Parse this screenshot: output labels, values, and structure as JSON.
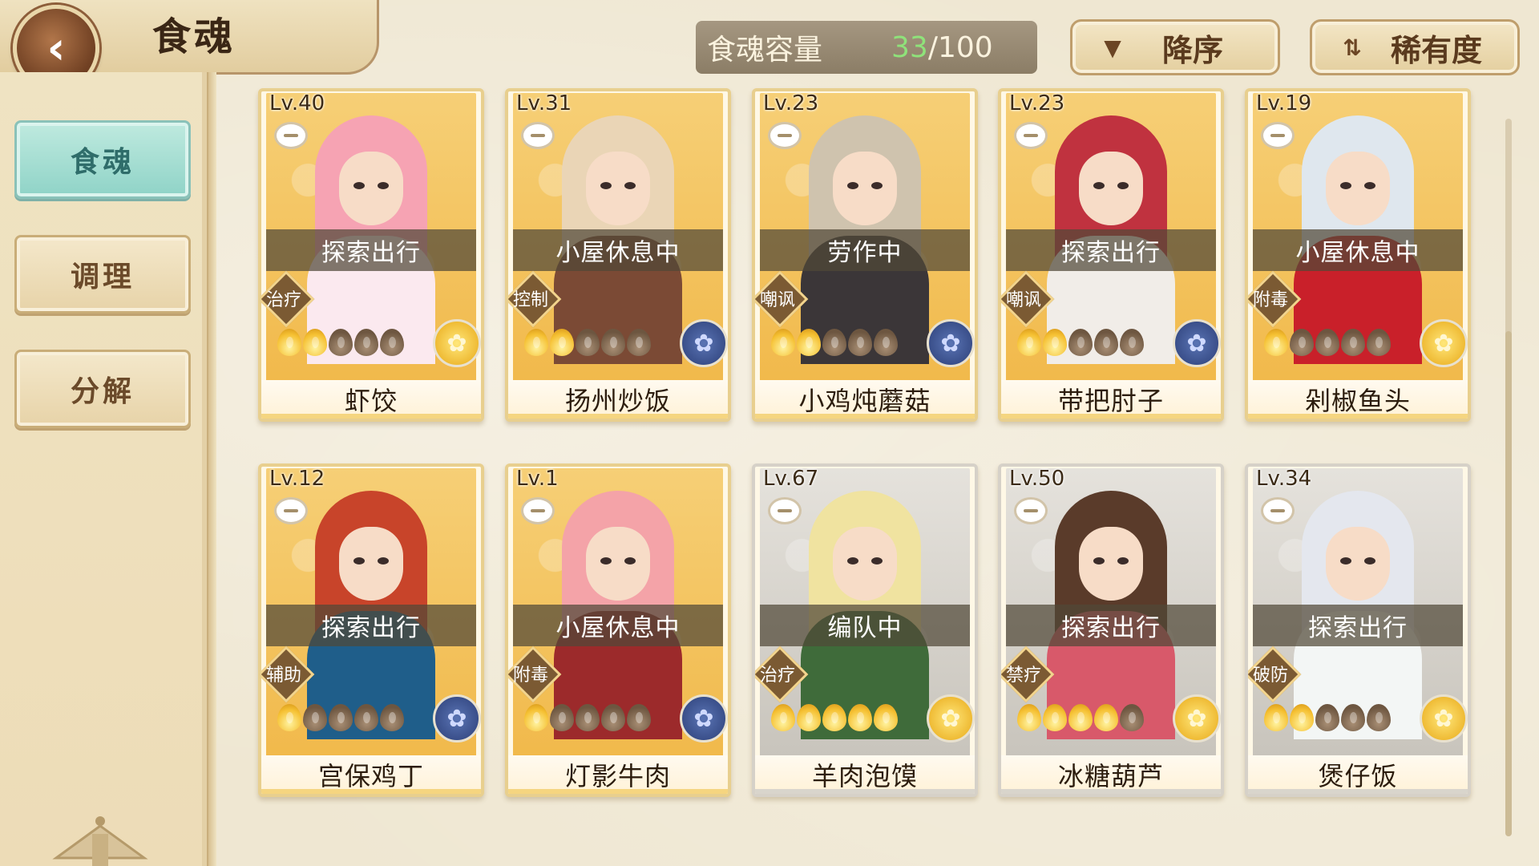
{
  "header": {
    "title": "食魂",
    "back_glyph": "‹",
    "capacity_label": "食魂容量",
    "capacity_current": "33",
    "capacity_total": "/100",
    "sort_order_label": "降序",
    "sort_order_icon": "triangle-down-icon",
    "sort_key_label": "稀有度",
    "sort_key_icon": "swap-arrows-icon"
  },
  "sidebar": {
    "tabs": [
      {
        "label": "食魂",
        "active": true
      },
      {
        "label": "调理",
        "active": false
      },
      {
        "label": "分解",
        "active": false
      }
    ]
  },
  "cards": [
    {
      "level": "Lv.40",
      "status": "探索出行",
      "role": "治疗",
      "flames_lit": 2,
      "name": "虾饺",
      "emblem": "gold",
      "frame": "gold",
      "hair": "#f6a3b3",
      "outfit": "#fbe9ef"
    },
    {
      "level": "Lv.31",
      "status": "小屋休息中",
      "role": "控制",
      "flames_lit": 2,
      "name": "扬州炒饭",
      "emblem": "blue",
      "frame": "gold",
      "hair": "#ead5b6",
      "outfit": "#7b4a35"
    },
    {
      "level": "Lv.23",
      "status": "劳作中",
      "role": "嘲讽",
      "flames_lit": 2,
      "name": "小鸡炖蘑菇",
      "emblem": "blue",
      "frame": "gold",
      "hair": "#cfc3ae",
      "outfit": "#3b3638"
    },
    {
      "level": "Lv.23",
      "status": "探索出行",
      "role": "嘲讽",
      "flames_lit": 2,
      "name": "带把肘子",
      "emblem": "blue",
      "frame": "gold",
      "hair": "#c0323f",
      "outfit": "#f1ede8"
    },
    {
      "level": "Lv.19",
      "status": "小屋休息中",
      "role": "附毒",
      "flames_lit": 1,
      "name": "剁椒鱼头",
      "emblem": "gold",
      "frame": "gold",
      "hair": "#dfe7ee",
      "outfit": "#c9202a"
    },
    {
      "level": "Lv.12",
      "status": "探索出行",
      "role": "辅助",
      "flames_lit": 1,
      "name": "宫保鸡丁",
      "emblem": "blue",
      "frame": "gold",
      "hair": "#c8442a",
      "outfit": "#1f5e8a"
    },
    {
      "level": "Lv.1",
      "status": "小屋休息中",
      "role": "附毒",
      "flames_lit": 1,
      "name": "灯影牛肉",
      "emblem": "blue",
      "frame": "gold",
      "hair": "#f4a3a8",
      "outfit": "#9c2a2b"
    },
    {
      "level": "Lv.67",
      "status": "编队中",
      "role": "治疗",
      "flames_lit": 5,
      "name": "羊肉泡馍",
      "emblem": "gold",
      "frame": "silver",
      "hair": "#f0e3a0",
      "outfit": "#3f6b3a"
    },
    {
      "level": "Lv.50",
      "status": "探索出行",
      "role": "禁疗",
      "flames_lit": 4,
      "name": "冰糖葫芦",
      "emblem": "gold",
      "frame": "silver",
      "hair": "#5a3b2a",
      "outfit": "#d8596a"
    },
    {
      "level": "Lv.34",
      "status": "探索出行",
      "role": "破防",
      "flames_lit": 2,
      "name": "煲仔饭",
      "emblem": "gold",
      "frame": "silver",
      "hair": "#e4e7ee",
      "outfit": "#f3f6f5"
    }
  ]
}
